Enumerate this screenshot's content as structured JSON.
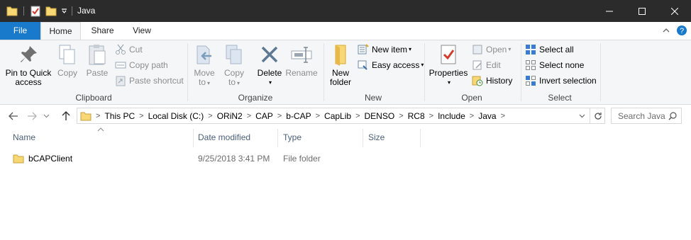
{
  "window": {
    "title": "Java",
    "icons": [
      "folder-icon",
      "properties-icon",
      "new-folder-icon",
      "chevron-down-icon"
    ],
    "controls": [
      "minimize-icon",
      "maximize-icon",
      "close-icon"
    ]
  },
  "tabs": {
    "file": "File",
    "home": "Home",
    "share": "Share",
    "view": "View"
  },
  "ribbon": {
    "clipboard": {
      "label": "Clipboard",
      "pin_line1": "Pin to Quick",
      "pin_line2": "access",
      "copy": "Copy",
      "paste": "Paste",
      "cut": "Cut",
      "copy_path": "Copy path",
      "paste_shortcut": "Paste shortcut"
    },
    "organize": {
      "label": "Organize",
      "move_line1": "Move",
      "move_line2": "to",
      "copy_line1": "Copy",
      "copy_line2": "to",
      "delete": "Delete",
      "rename": "Rename"
    },
    "new": {
      "label": "New",
      "folder_line1": "New",
      "folder_line2": "folder",
      "new_item": "New item",
      "easy_access": "Easy access"
    },
    "open": {
      "label": "Open",
      "properties": "Properties",
      "open": "Open",
      "edit": "Edit",
      "history": "History"
    },
    "select": {
      "label": "Select",
      "select_all": "Select all",
      "select_none": "Select none",
      "invert": "Invert selection"
    }
  },
  "address": {
    "crumbs": [
      "This PC",
      "Local Disk (C:)",
      "ORiN2",
      "CAP",
      "b-CAP",
      "CapLib",
      "DENSO",
      "RC8",
      "Include",
      "Java"
    ],
    "search_placeholder": "Search Java"
  },
  "columns": {
    "name": "Name",
    "date": "Date modified",
    "type": "Type",
    "size": "Size"
  },
  "files": [
    {
      "name": "bCAPClient",
      "date": "9/25/2018 3:41 PM",
      "type": "File folder",
      "size": ""
    }
  ],
  "colors": {
    "titlebar": "#2b2b2b",
    "file_tab": "#1979ca",
    "ribbon_bg": "#f5f6f7",
    "folder_yellow": "#f8d775",
    "column_header": "#4c607a"
  }
}
